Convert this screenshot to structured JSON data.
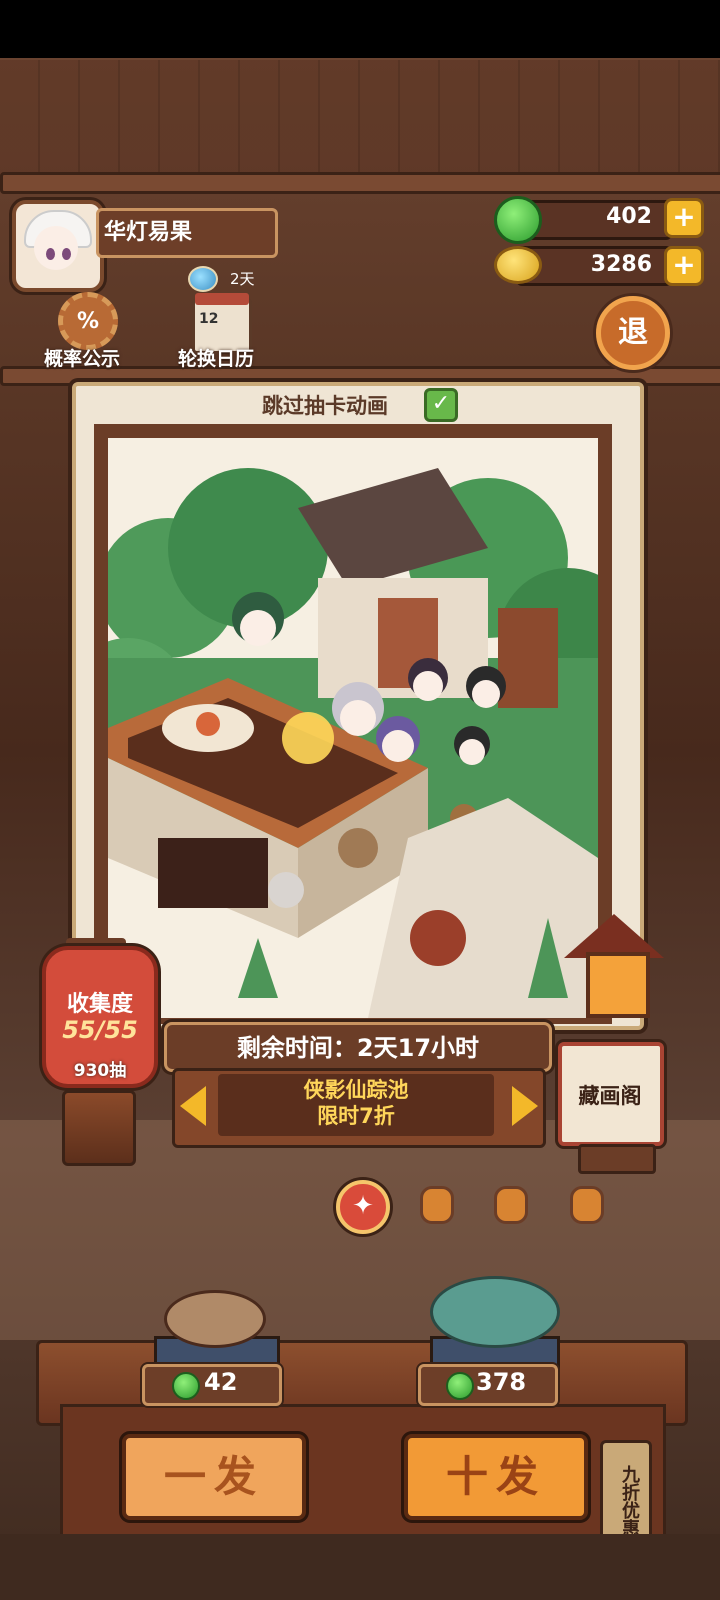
{
  "player": {
    "name": "华灯易果",
    "days_label": "2天"
  },
  "currency": {
    "jade": "402",
    "coins": "3286",
    "jade_icon": "jade-coin-icon",
    "coin_icon": "copper-coin-icon",
    "plus_icon": "plus-icon"
  },
  "menu": {
    "probability_label": "概率公示",
    "probability_symbol": "%",
    "calendar_label": "轮换日历",
    "calendar_number": "12",
    "exit_label": "退"
  },
  "card": {
    "skip_label": "跳过抽卡动画",
    "skip_checked": true
  },
  "collection": {
    "label": "收集度",
    "value": "55/55",
    "draws": "930抽"
  },
  "pool": {
    "time_remaining": "剩余时间：2天17小时",
    "name_line1": "侠影仙踪池",
    "name_line2": "限时7折",
    "page_count": 4,
    "active_page": 1
  },
  "gallery": {
    "label": "藏画阁"
  },
  "draw": {
    "single_cost": "42",
    "single_label": "一发",
    "ten_cost": "378",
    "ten_label": "十发",
    "discount_tag": "九折优惠"
  },
  "colors": {
    "accent_gold": "#f3b829",
    "button_orange": "#f29a36",
    "lantern_red": "#d34c3b",
    "jade_green": "#2b9b2d"
  }
}
